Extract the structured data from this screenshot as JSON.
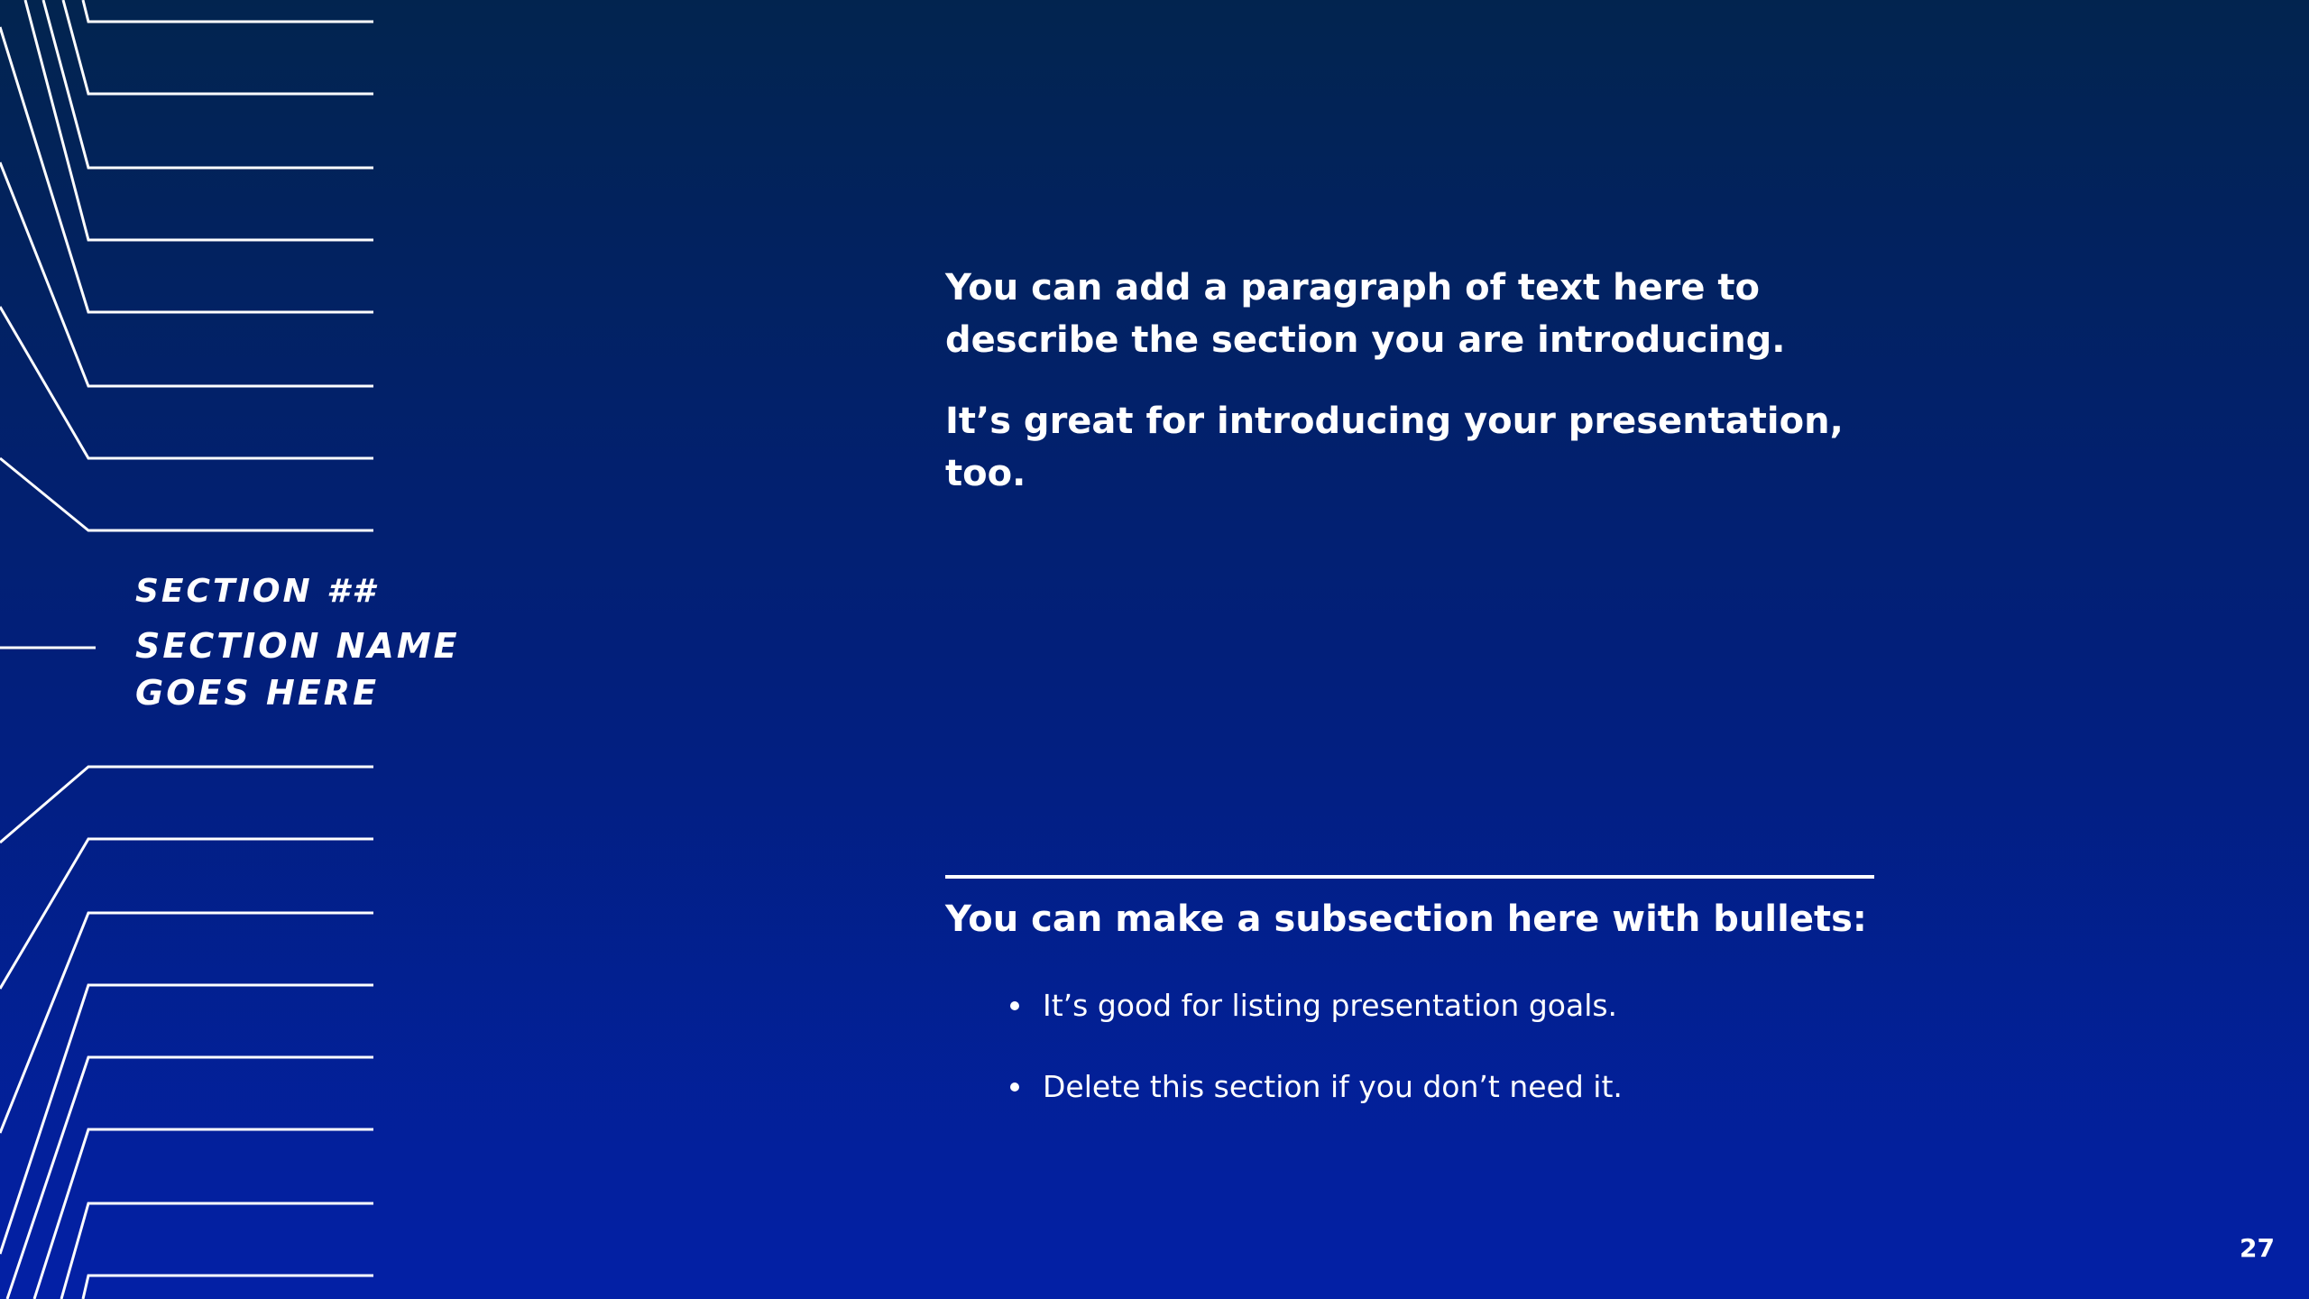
{
  "section": {
    "number": "SECTION ##",
    "name": "SECTION NAME GOES HERE"
  },
  "intro": {
    "paragraph_1": "You can add a paragraph of text here to describe the section you are introducing.",
    "paragraph_2": "It’s great for introducing your presentation, too."
  },
  "subsection": {
    "heading": "You can make a subsection here with bullets:",
    "bullets": [
      "It’s good for listing presentation goals.",
      "Delete this section if you don’t need it."
    ]
  },
  "page_number": "27",
  "colors": {
    "background_top": "#02244f",
    "background_bottom": "#0320a6",
    "text": "#ffffff"
  }
}
